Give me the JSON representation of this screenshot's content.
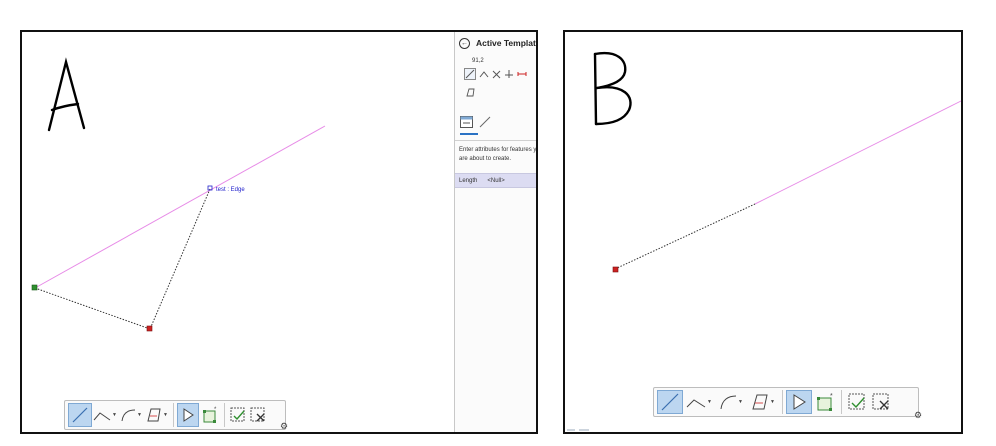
{
  "panels": {
    "a": {
      "letter": "A",
      "snap_label": "test : Edge"
    },
    "b": {
      "letter": "B"
    }
  },
  "template_pane": {
    "title": "Active Template",
    "tool_id": "91,2",
    "help_text": "Enter attributes for features you are about to create.",
    "attribute": {
      "label": "Length",
      "value": "<Null>"
    }
  },
  "icons": {
    "back": "back-arrow-circle-icon",
    "line": "line-icon",
    "polyline": "polyline-icon",
    "arc": "arc-icon",
    "polygon": "polygon-icon",
    "select": "select-arrow-icon",
    "vertex_edit": "vertex-edit-icon",
    "finish": "finish-sketch-icon",
    "discard": "discard-sketch-icon",
    "settings": "gear-icon"
  },
  "colors": {
    "edge": "#e78be7",
    "sketch": "#333333",
    "start_vertex": "#2f8f2f",
    "end_vertex": "#cc2222",
    "snap_label": "#2222cc",
    "active_tool": "#bcd6f0"
  }
}
